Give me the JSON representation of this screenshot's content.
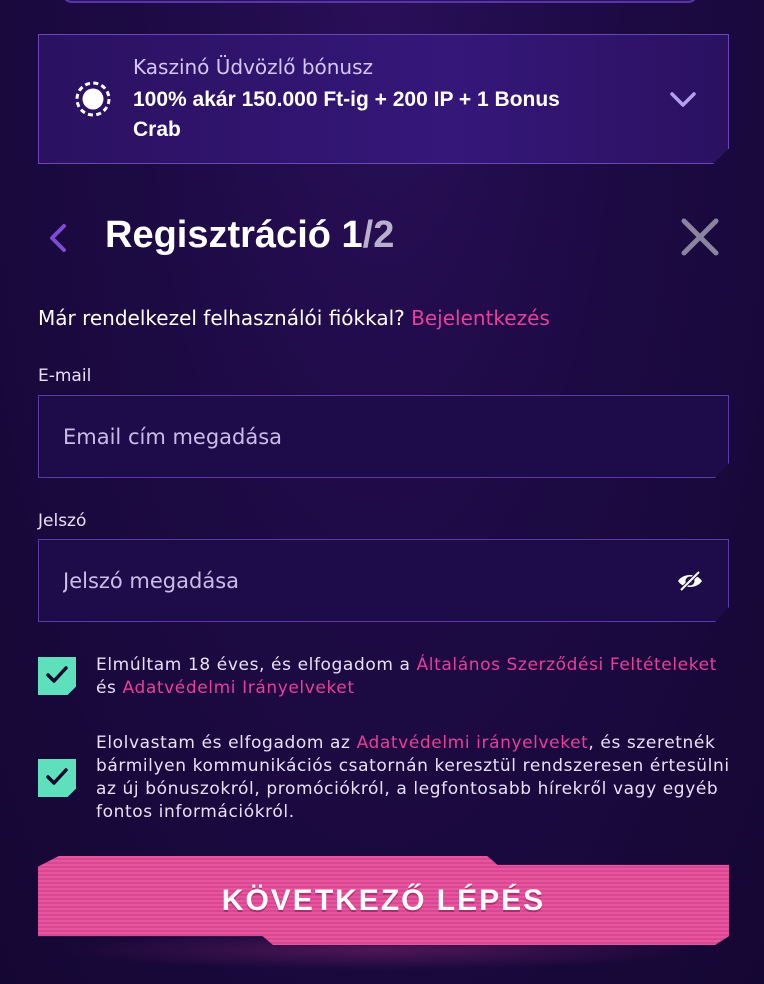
{
  "bonus": {
    "label": "Kaszinó Üdvözlő bónusz",
    "value": "100% akár 150.000 Ft-ig + 200 IP + 1 Bonus Crab"
  },
  "header": {
    "title": "Regisztráció 1",
    "step_total": "/2"
  },
  "login": {
    "question": "Már rendelkezel felhasználói fiókkal?",
    "link": "Bejelentkezés"
  },
  "email": {
    "label": "E-mail",
    "placeholder": "Email cím megadása"
  },
  "password": {
    "label": "Jelszó",
    "placeholder": "Jelszó megadása"
  },
  "consent_age": {
    "text_start": "Elmúltam 18 éves, és elfogadom a ",
    "terms_link": "Általános Szerződési Feltételeket",
    "and": " és ",
    "privacy_link": "Adatvédelmi Irányelveket"
  },
  "consent_marketing": {
    "text_start": "Elolvastam és elfogadom az ",
    "privacy_link": "Adatvédelmi irányelveket",
    "text_end": ", és szeretnék bármilyen kommunikációs csatornán keresztül rendszeresen értesülni az új bónuszokról, promóciókról, a legfontosabb hírekről vagy egyéb fontos információkról."
  },
  "cta": {
    "label": "KÖVETKEZŐ LÉPÉS"
  },
  "colors": {
    "accent_pink": "#ec3d9c",
    "check_green": "#5fe0bd",
    "background": "#1d0a44"
  },
  "icons": {
    "bonus": "casino-chip-icon",
    "expand": "chevron-down-icon",
    "back": "chevron-left-icon",
    "close": "close-icon",
    "password_toggle": "eye-slash-icon",
    "checkbox": "checkmark-icon"
  }
}
